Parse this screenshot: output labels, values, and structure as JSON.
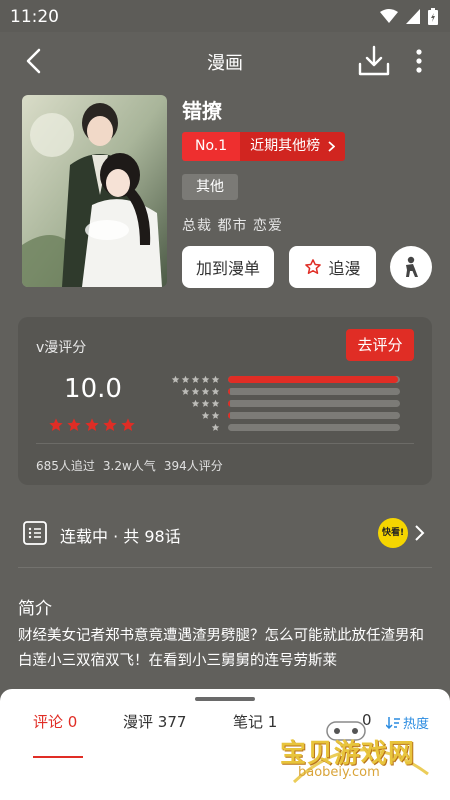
{
  "status_bar": {
    "time": "11:20"
  },
  "nav": {
    "title": "漫画"
  },
  "comic": {
    "title": "错撩",
    "rank_no": "No.1",
    "rank_list": "近期其他榜",
    "genre": "其他",
    "tags": "总裁 都市 恋爱"
  },
  "actions": {
    "add_to_manga": "加到漫单",
    "follow": "追漫"
  },
  "rating": {
    "label": "v漫评分",
    "rate_button": "去评分",
    "score": "10.0",
    "score_stars": 5,
    "distribution": [
      {
        "stars": 5,
        "fraction": 0.99
      },
      {
        "stars": 4,
        "fraction": 0.01
      },
      {
        "stars": 3,
        "fraction": 0.01
      },
      {
        "stars": 2,
        "fraction": 0.01
      },
      {
        "stars": 1,
        "fraction": 0.0
      }
    ],
    "followers": "685人追过",
    "popularity": "3.2w人气",
    "raters": "394人评分"
  },
  "serial": {
    "status_text": "连载中 · 共 98话",
    "badge": "快看!"
  },
  "intro": {
    "heading": "简介",
    "text": "财经美女记者郑书意竟遭遇渣男劈腿？怎么可能就此放任渣男和白莲小三双宿双飞！在看到小三舅舅的连号劳斯莱"
  },
  "tabs": [
    {
      "label": "评论",
      "count": "0"
    },
    {
      "label": "漫评",
      "count": "377"
    },
    {
      "label": "笔记",
      "count": "1"
    },
    {
      "label": "",
      "count": "0"
    }
  ],
  "sort_label": "热度",
  "watermark": {
    "text": "宝贝游戏网",
    "url": "baobeiy.com"
  },
  "colors": {
    "accent": "#e02d25",
    "background": "#61605c",
    "sort_blue": "#2a8be0"
  }
}
